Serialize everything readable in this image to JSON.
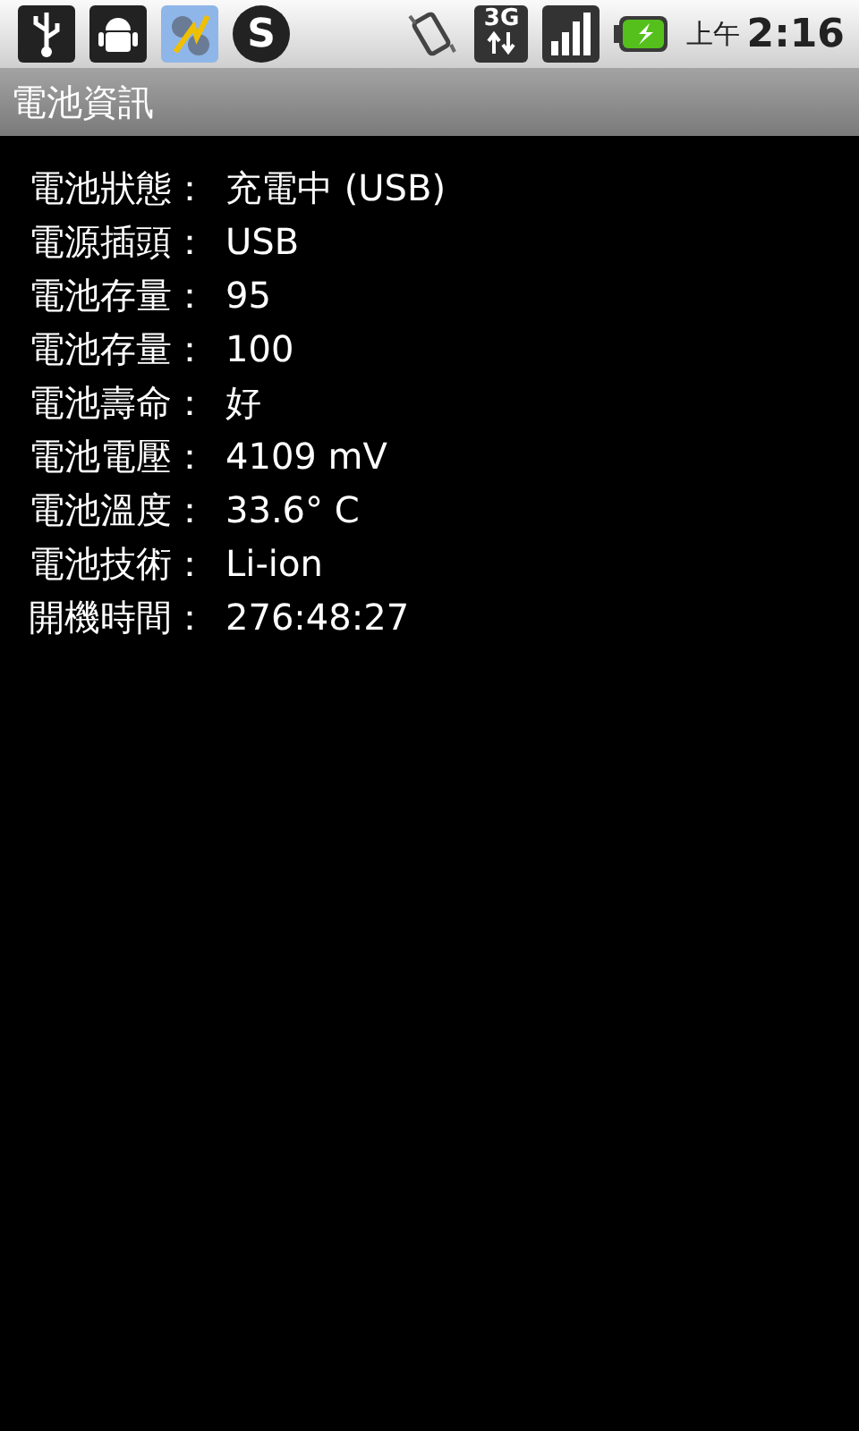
{
  "status_bar": {
    "notification_glyph": "S",
    "network_type": "3G",
    "am_pm": "上午",
    "time": "2:16"
  },
  "title_bar": {
    "title": "電池資訊"
  },
  "rows": [
    {
      "label": "電池狀態：",
      "value": "充電中 (USB)"
    },
    {
      "label": "電源插頭：",
      "value": "USB"
    },
    {
      "label": "電池存量：",
      "value": "95"
    },
    {
      "label": "電池存量：",
      "value": "100"
    },
    {
      "label": "電池壽命：",
      "value": "好"
    },
    {
      "label": "電池電壓：",
      "value": "4109 mV"
    },
    {
      "label": "電池溫度：",
      "value": "33.6° C"
    },
    {
      "label": "電池技術：",
      "value": "Li-ion"
    },
    {
      "label": "開機時間：",
      "value": "276:48:27"
    }
  ]
}
